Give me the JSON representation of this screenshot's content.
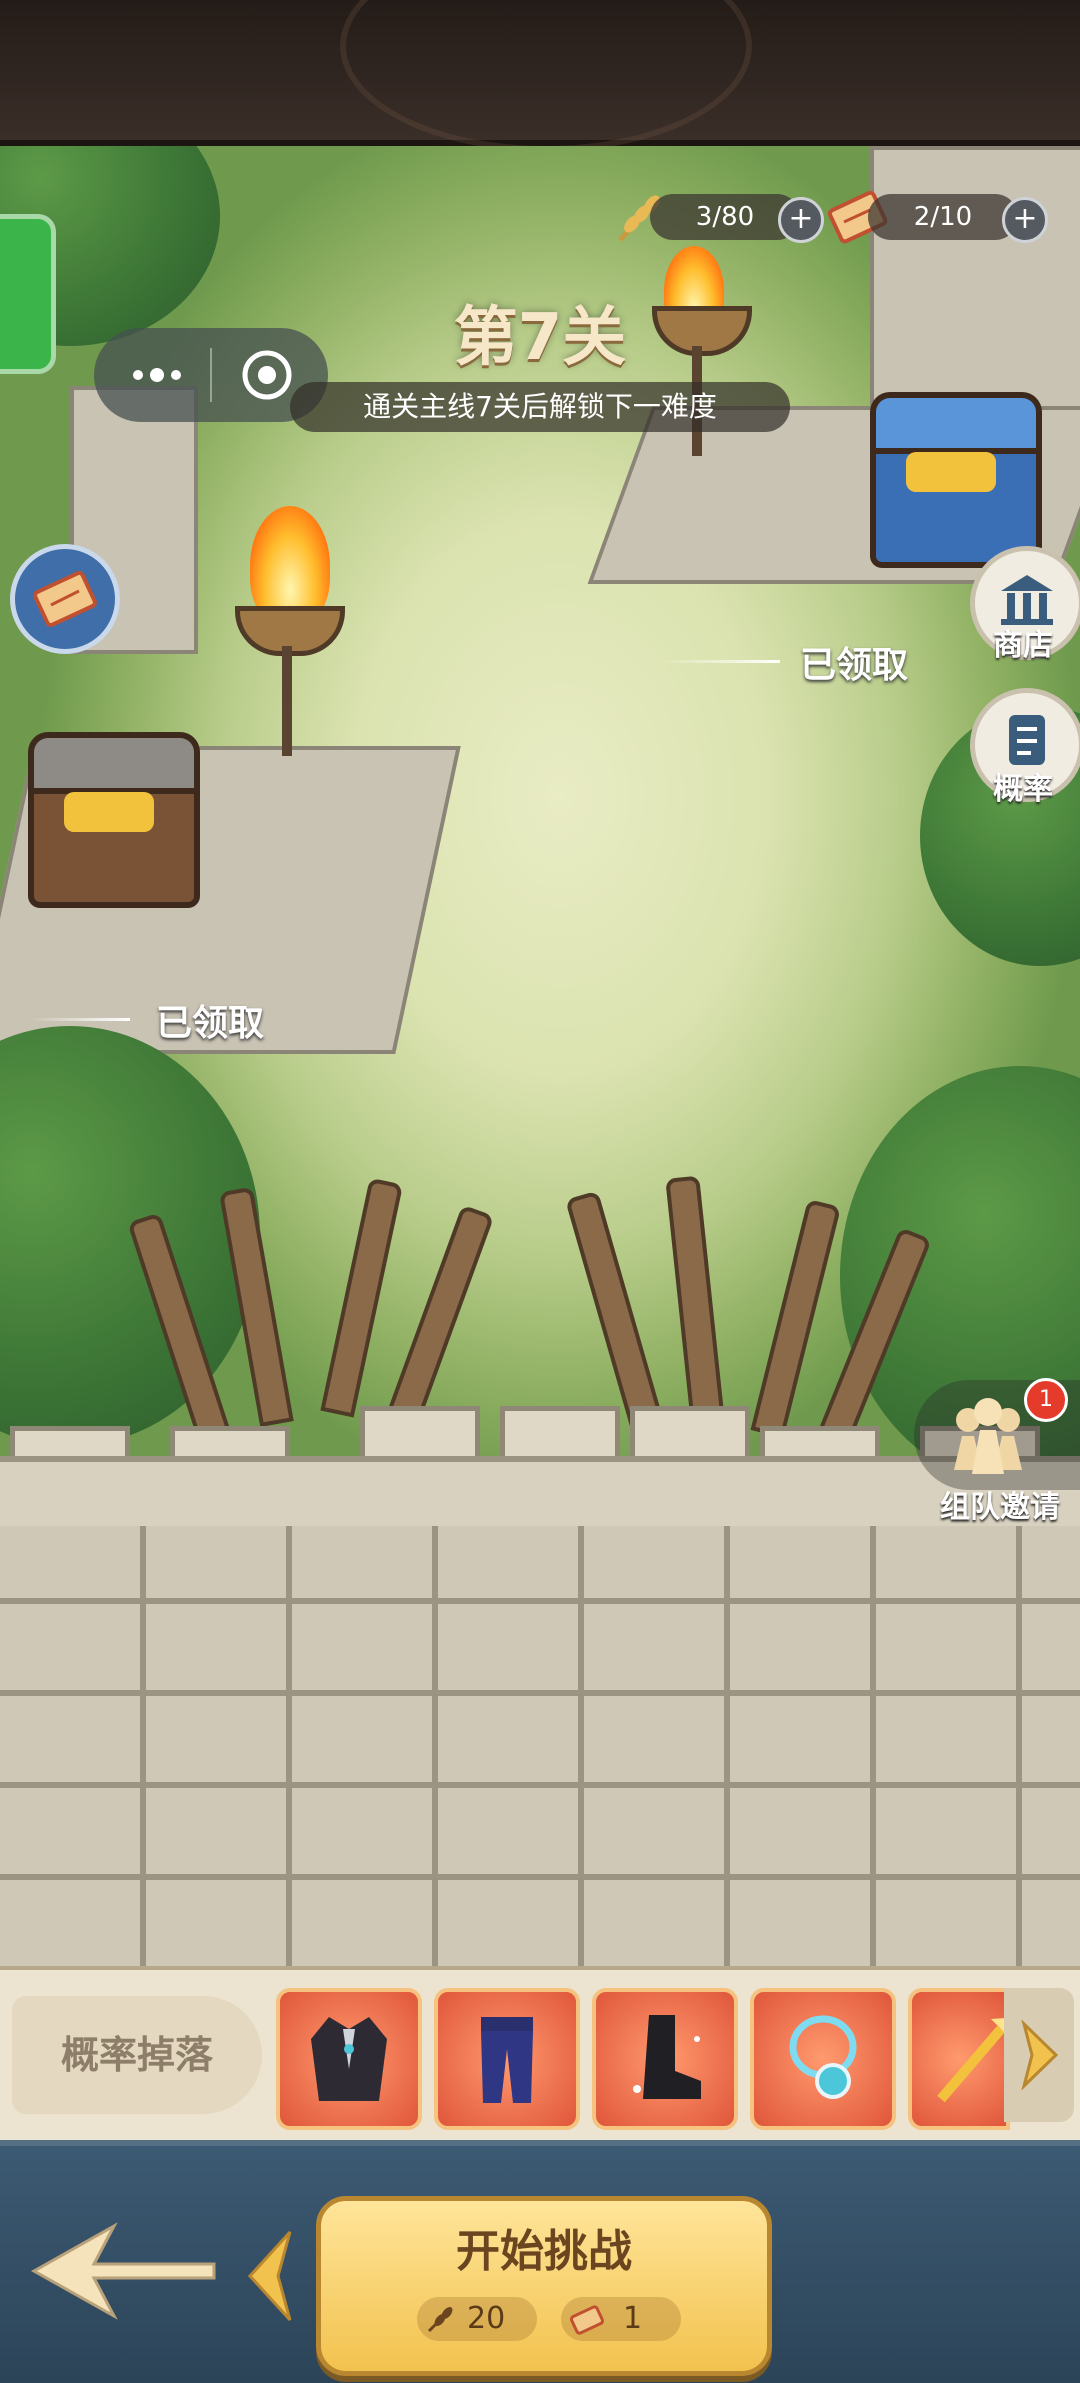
{
  "hud": {
    "stamina": "3/80",
    "tickets": "2/10"
  },
  "stage": {
    "title": "第7关",
    "subtitle": "通关主线7关后解锁下一难度"
  },
  "chests": {
    "right_status": "已领取",
    "left_status": "已领取"
  },
  "side_menu": {
    "shop": "商店",
    "probability": "概率",
    "team_invite": "组队邀请",
    "team_invite_badge": "1"
  },
  "drops": {
    "label": "概率掉落",
    "items": [
      "coat-icon",
      "pants-icon",
      "boots-icon",
      "necklace-icon",
      "weapon-icon"
    ]
  },
  "action": {
    "start_label": "开始挑战",
    "stamina_cost": "20",
    "ticket_cost": "1"
  }
}
